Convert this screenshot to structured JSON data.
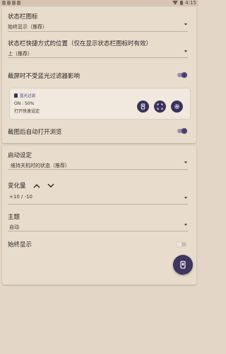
{
  "status_bar": {
    "time": "4:15"
  },
  "settings_top": {
    "status_icon": {
      "label": "状态栏图标",
      "value": "始终显示（推荐）"
    },
    "shortcut_position": {
      "label": "状态栏快捷方式的位置（仅在显示状态栏图标时有效）",
      "value": "上（推荐）"
    },
    "screenshot_unaffected": {
      "label": "截屏时不受蓝光过滤器影响",
      "enabled": true
    }
  },
  "widget": {
    "app_name": "蓝光过滤",
    "status": "ON : 50%",
    "open_settings": "打开快速设定"
  },
  "auto_open": {
    "label": "截图后自动打开浏览",
    "enabled": true
  },
  "settings_bottom": {
    "startup": {
      "label": "启动设定",
      "value": "维持关机时的状态（推荐）"
    },
    "variation": {
      "label": "变化量",
      "value": "+10 / -10"
    },
    "theme": {
      "label": "主题",
      "value": "自动"
    },
    "always_show": {
      "label": "始终显示",
      "enabled": false
    }
  },
  "colors": {
    "accent": "#3A325A",
    "background": "#E4D6C6",
    "card": "#E8DCCD"
  }
}
